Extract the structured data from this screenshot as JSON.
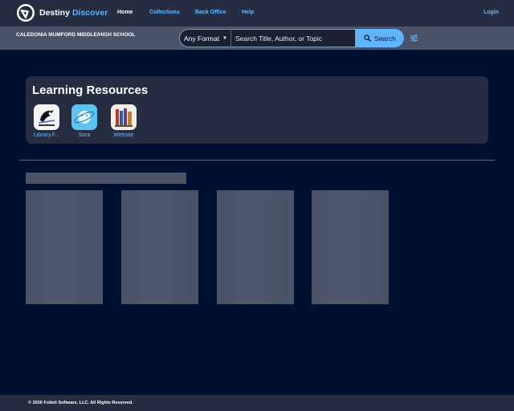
{
  "app": {
    "brand_primary": "Destiny",
    "brand_secondary": "Discover"
  },
  "nav": {
    "home": "Home",
    "collections": "Collections",
    "back_office": "Back Office",
    "help": "Help",
    "login": "Login"
  },
  "search": {
    "school": "CALEDONIA MUMFORD MIDDLE/HIGH SCHOOL",
    "format": "Any Format",
    "placeholder": "Search Title, Author, or Topic",
    "button_label": "Search"
  },
  "learning_resources": {
    "title": "Learning Resources",
    "items": [
      {
        "label": "Library.F...",
        "icon": "library-crow-icon"
      },
      {
        "label": "Sora",
        "icon": "sora-icon"
      },
      {
        "label": "Website",
        "icon": "books-icon"
      }
    ]
  },
  "footer": {
    "copyright": "© 2026 Follett Software, LLC. All Rights Reserved."
  },
  "colors": {
    "background": "#001030",
    "topbar": "#262d42",
    "accent": "#5fb3ff",
    "skeleton": "#4a5268"
  }
}
